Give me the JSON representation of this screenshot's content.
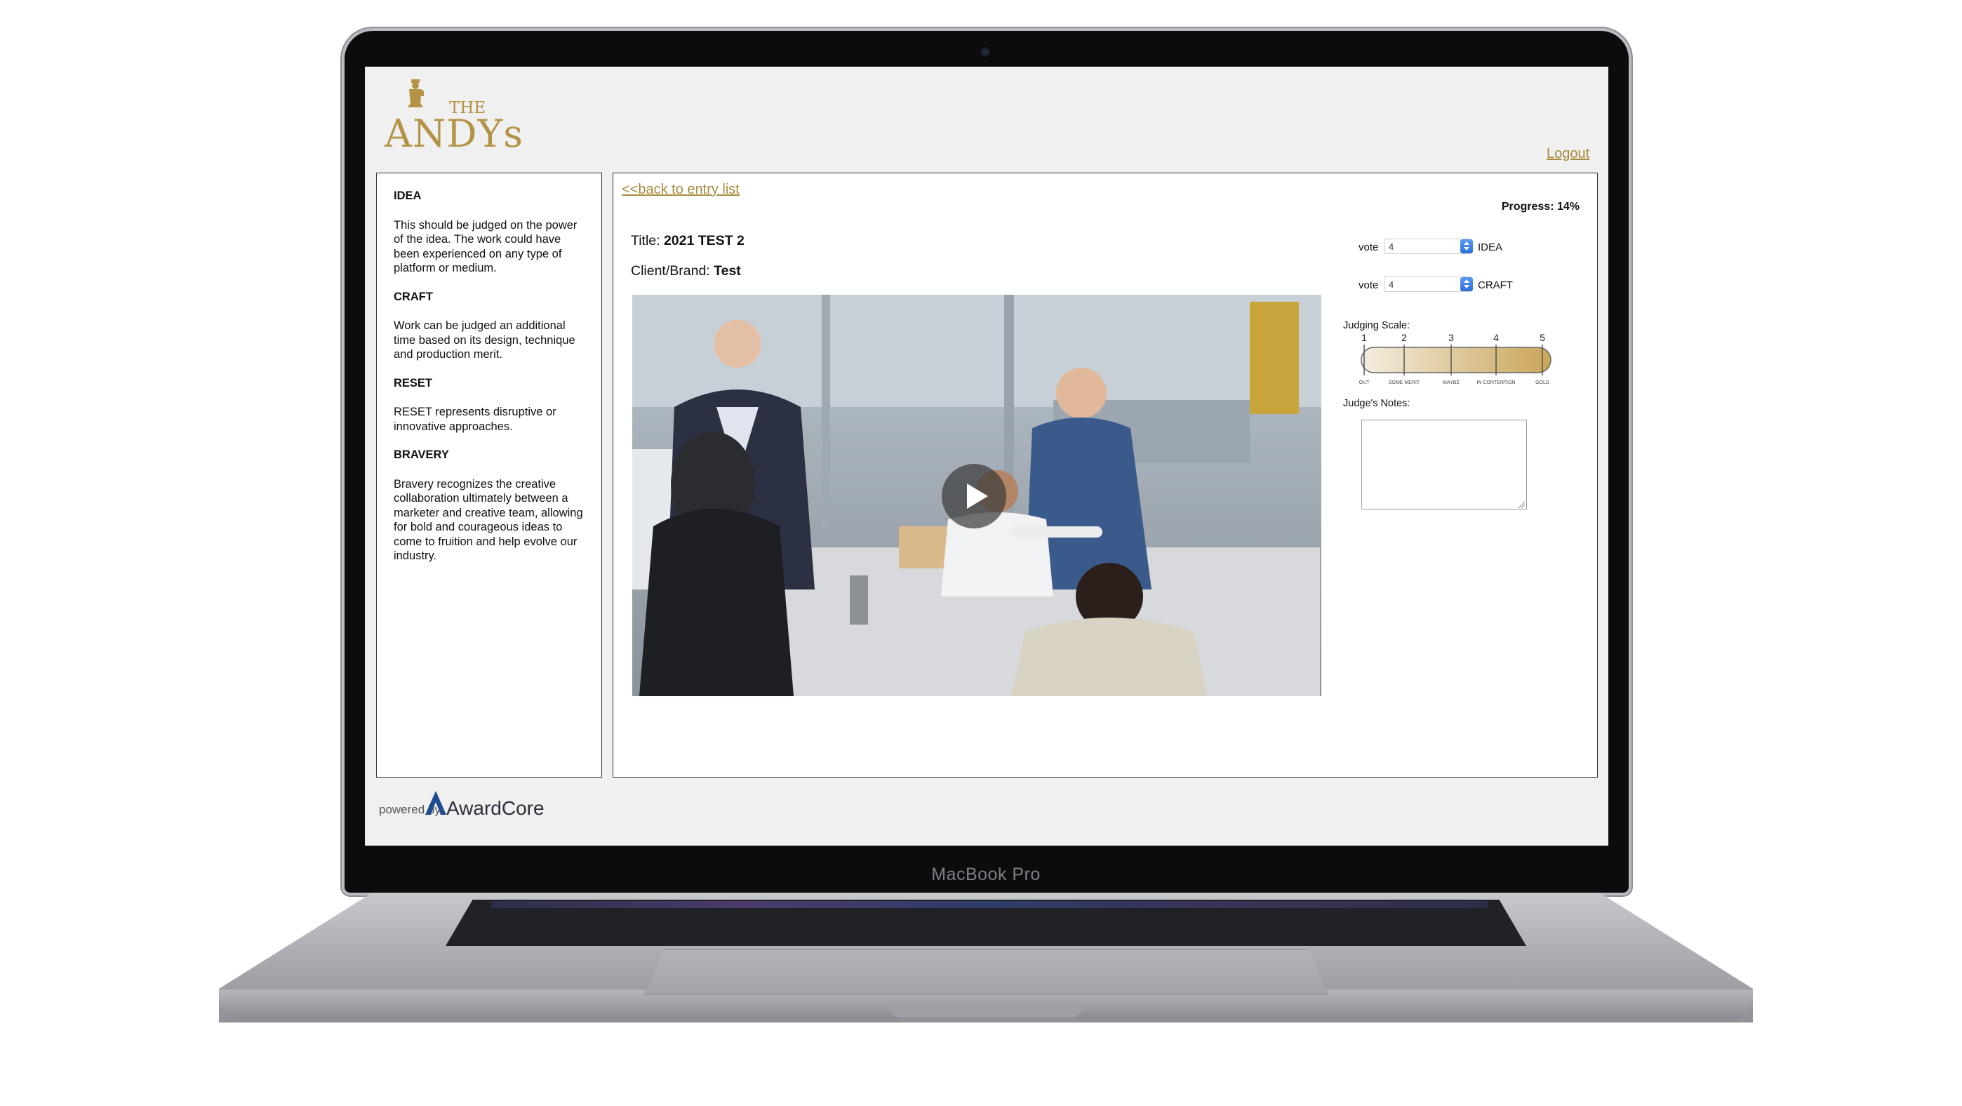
{
  "device": {
    "label": "MacBook Pro"
  },
  "logo": {
    "the": "THE",
    "andys": "ANDYs"
  },
  "header": {
    "logout_label": "Logout"
  },
  "criteria": [
    {
      "title": "IDEA",
      "description": "This should be judged on the power of the idea. The work could have been experienced on any type of platform or medium."
    },
    {
      "title": "CRAFT",
      "description": "Work can be judged an additional time based on its design, technique and production merit."
    },
    {
      "title": "RESET",
      "description": "RESET represents disruptive or innovative approaches."
    },
    {
      "title": "BRAVERY",
      "description": "Bravery recognizes the creative collaboration ultimately between a marketer and creative team, allowing for bold and courageous ideas to come to fruition and help evolve our industry."
    }
  ],
  "entry": {
    "back_label": "<<back to entry list",
    "progress_label": "Progress: 14%",
    "title_label": "Title: ",
    "title_value": "2021 TEST 2",
    "client_label": "Client/Brand: ",
    "client_value": "Test"
  },
  "votes": [
    {
      "label": "vote",
      "value": "4",
      "criterion": "IDEA"
    },
    {
      "label": "vote",
      "value": "4",
      "criterion": "CRAFT"
    }
  ],
  "judging_scale": {
    "title": "Judging Scale:",
    "numbers": [
      "1",
      "2",
      "3",
      "4",
      "5"
    ],
    "captions": [
      "OUT",
      "SOME MERIT",
      "MAYBE",
      "IN CONTENTION",
      "GOLD"
    ]
  },
  "notes": {
    "label": "Judge's Notes:",
    "value": ""
  },
  "footer": {
    "powered_by": "powered by",
    "brand": "AwardCore"
  },
  "colors": {
    "accent_gold": "#a78a3c",
    "logo_gold": "#b39346",
    "screen_bg": "#f0f0f0"
  }
}
